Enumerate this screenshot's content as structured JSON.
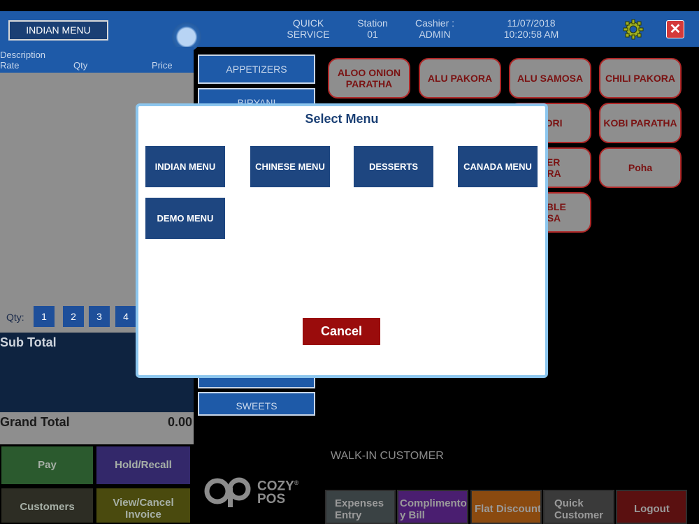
{
  "header": {
    "menu_title": "INDIAN MENU",
    "mode_line1": "QUICK",
    "mode_line2": "SERVICE",
    "station_label": "Station",
    "station_value": "01",
    "cashier_label": "Cashier :",
    "cashier_value": "ADMIN",
    "date": "11/07/2018",
    "time": "10:20:58 AM",
    "settings_icon": "gear-icon",
    "close_icon": "close-icon",
    "close_glyph": "✕"
  },
  "order": {
    "col_description": "Description",
    "col_rate": "Rate",
    "col_qty": "Qty",
    "col_price": "Price",
    "qty_label": "Qty:",
    "qty_buttons": [
      "1",
      "2",
      "3",
      "4"
    ],
    "subtotal_label": "Sub Total",
    "grand_total_label": "Grand Total",
    "grand_total_value": "0.00"
  },
  "actions": {
    "pay": "Pay",
    "hold_recall": "Hold/Recall",
    "customers": "Customers",
    "view_cancel_line1": "View/Cancel",
    "view_cancel_line2": "Invoice"
  },
  "categories": {
    "appetizers": "APPETIZERS",
    "biryani": "BIRYANI",
    "sweets": "SWEETS"
  },
  "items": {
    "aloo_onion_line1": "ALOO ONION",
    "aloo_onion_line2": "PARATHA",
    "alu_pakora": "ALU PAKORA",
    "alu_samosa": "ALU SAMOSA",
    "chili_pakora": "CHILI PAKORA",
    "hori": "HORI",
    "kobi_paratha": "KOBI PARATHA",
    "paneer_line1": "EER",
    "paneer_line2": "ORA",
    "poha": "Poha",
    "veg_line1": "TABLE",
    "veg_line2": "OSA"
  },
  "customer": {
    "walk_in": "WALK-IN CUSTOMER"
  },
  "logo": {
    "line1": "COZY",
    "line2": "POS",
    "reg": "®"
  },
  "bottom": {
    "expenses_line1": "Expenses",
    "expenses_line2": "Entry",
    "complimentary_line1": "Complimentor",
    "complimentary_line2": "y Bill",
    "flat_discount": "Flat Discount",
    "quick_customer_line1": "Quick",
    "quick_customer_line2": "Customer",
    "logout": "Logout"
  },
  "modal": {
    "title": "Select Menu",
    "options": [
      "INDIAN MENU",
      "CHINESE MENU",
      "DESSERTS",
      "CANADA MENU",
      "DEMO MENU"
    ],
    "cancel": "Cancel"
  },
  "colors": {
    "header_blue": "#1e5aa8",
    "modal_button": "#1e4680",
    "cancel_red": "#9a0c0c",
    "item_border": "#b02828"
  }
}
